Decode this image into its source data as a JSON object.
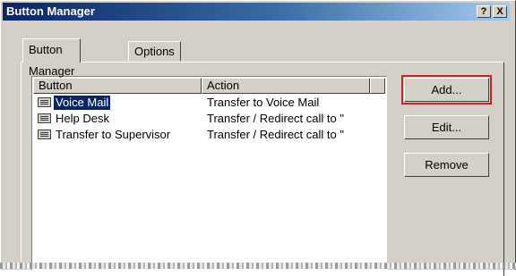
{
  "window": {
    "title": "Button Manager",
    "help_label": "?",
    "close_label": "X"
  },
  "tabs": [
    {
      "label": "Button Manager"
    },
    {
      "label": "Options"
    }
  ],
  "list": {
    "columns": [
      "Button",
      "Action"
    ],
    "rows": [
      {
        "name": "Voice Mail",
        "action": "Transfer to Voice Mail",
        "selected": true
      },
      {
        "name": "Help Desk",
        "action": "Transfer / Redirect call to \""
      },
      {
        "name": "Transfer to Supervisor",
        "action": "Transfer / Redirect call to \""
      }
    ]
  },
  "buttons": {
    "add": "Add...",
    "edit": "Edit...",
    "remove": "Remove"
  },
  "colors": {
    "titlebar_start": "#0a246a",
    "selection": "#0a246a",
    "highlight_outline": "#c0272d",
    "face": "#d4d0c8"
  }
}
